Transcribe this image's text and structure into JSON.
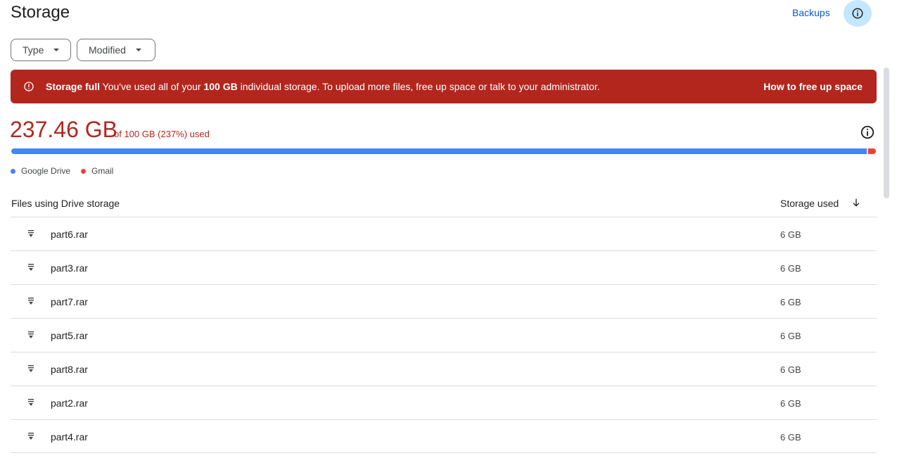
{
  "header": {
    "title": "Storage",
    "backups_label": "Backups",
    "info_icon": "info-icon"
  },
  "filters": {
    "type_label": "Type",
    "modified_label": "Modified"
  },
  "banner": {
    "title": "Storage full",
    "message_prefix": "You've used all of your",
    "message_bold": "100 GB",
    "message_suffix": "individual storage. To upload more files, free up space or talk to your administrator.",
    "action_label": "How to free up space",
    "color": "#b3261e"
  },
  "usage": {
    "used": "237.46 GB",
    "detail": "of 100 GB (237%) used",
    "drive_fraction": 0.991,
    "gmail_fraction": 0.009,
    "drive_color": "#4285f4",
    "gmail_color": "#ea4335",
    "legend": [
      {
        "label": "Google Drive",
        "color": "#4285f4"
      },
      {
        "label": "Gmail",
        "color": "#ea4335"
      }
    ]
  },
  "files": {
    "header_name": "Files using Drive storage",
    "header_size": "Storage used",
    "sort_icon": "arrow-down-icon",
    "rows": [
      {
        "name": "part6.rar",
        "size": "6 GB"
      },
      {
        "name": "part3.rar",
        "size": "6 GB"
      },
      {
        "name": "part7.rar",
        "size": "6 GB"
      },
      {
        "name": "part5.rar",
        "size": "6 GB"
      },
      {
        "name": "part8.rar",
        "size": "6 GB"
      },
      {
        "name": "part2.rar",
        "size": "6 GB"
      },
      {
        "name": "part4.rar",
        "size": "6 GB"
      }
    ]
  }
}
